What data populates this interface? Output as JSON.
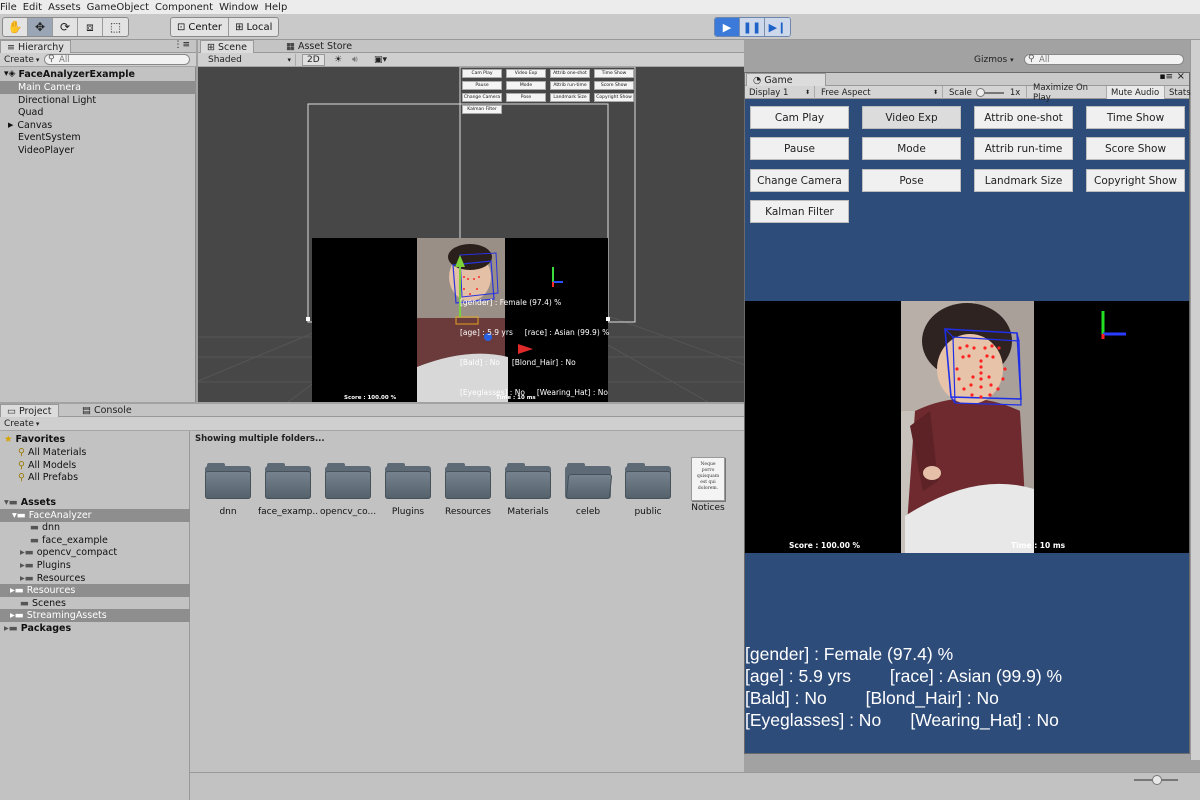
{
  "menu": [
    "File",
    "Edit",
    "Assets",
    "GameObject",
    "Component",
    "Window",
    "Help"
  ],
  "toolbar": {
    "tools": [
      "hand-icon",
      "move-icon",
      "rotate-icon",
      "scale-icon",
      "rect-icon"
    ],
    "pivot": "Center",
    "space": "Local",
    "play_controls": [
      "play-icon",
      "pause-icon",
      "step-icon"
    ]
  },
  "hierarchy": {
    "tab": "Hierarchy",
    "create": "Create",
    "search_placeholder": "All",
    "scene": "FaceAnalyzerExample",
    "items": [
      "Main Camera",
      "Directional Light",
      "Quad",
      "Canvas",
      "EventSystem",
      "VideoPlayer"
    ]
  },
  "scene": {
    "tabs": [
      "Scene",
      "Asset Store"
    ],
    "shading": "Shaded",
    "mode_2d": "2D",
    "gizmos": "Gizmos",
    "search_placeholder": "All",
    "mini_buttons": [
      "Cam Play",
      "Video Exp",
      "Attrib one-shot",
      "Time Show",
      "Pause",
      "Mode",
      "Attrib run-time",
      "Score Show",
      "Change Camera",
      "Pose",
      "Landmark Size",
      "Copyright Show",
      "Kalman Filter"
    ],
    "overlay_lines": [
      "[gender] : Female (97.4) %",
      "[age] : 5.9 yrs     [race] : Asian (99.9) %",
      "[Bald] : No     [Blond_Hair] : No",
      "[Eyeglasses] : No     [Wearing_Hat] : No"
    ],
    "score": "Score : 100.00 %",
    "time": "Time : 10 ms"
  },
  "project": {
    "tabs": [
      "Project",
      "Console"
    ],
    "create": "Create",
    "header": "Showing multiple folders...",
    "favorites_label": "Favorites",
    "favorites": [
      "All Materials",
      "All Models",
      "All Prefabs"
    ],
    "assets_label": "Assets",
    "tree": [
      {
        "label": "FaceAnalyzer",
        "indent": 1,
        "selected": true
      },
      {
        "label": "dnn",
        "indent": 2,
        "selected": false
      },
      {
        "label": "face_example",
        "indent": 2,
        "selected": false
      },
      {
        "label": "opencv_compact",
        "indent": 2,
        "selected": false
      },
      {
        "label": "Plugins",
        "indent": 2,
        "selected": false
      },
      {
        "label": "Resources",
        "indent": 2,
        "selected": false
      },
      {
        "label": "Resources",
        "indent": 1,
        "selected": true
      },
      {
        "label": "Scenes",
        "indent": 1,
        "selected": false
      },
      {
        "label": "StreamingAssets",
        "indent": 1,
        "selected": true
      }
    ],
    "packages_label": "Packages",
    "folders": [
      "dnn",
      "face_examp...",
      "opencv_co...",
      "Plugins",
      "Resources",
      "Materials",
      "celeb",
      "public",
      "Notices"
    ],
    "notices_preview": "Neque porro quisquam est qui dolorem."
  },
  "game": {
    "tab": "Game",
    "display": "Display 1",
    "aspect": "Free Aspect",
    "scale_label": "Scale",
    "scale_value": "1x",
    "maximize": "Maximize On Play",
    "mute": "Mute Audio",
    "stats": "Stats",
    "buttons": [
      "Cam Play",
      "Video Exp",
      "Attrib one-shot",
      "Time Show",
      "Pause",
      "Mode",
      "Attrib run-time",
      "Score Show",
      "Change Camera",
      "Pose",
      "Landmark Size",
      "Copyright Show",
      "Kalman Filter"
    ],
    "score": "Score : 100.00 %",
    "time": "Time : 10 ms",
    "attributes": [
      "[gender] : Female (97.4) %",
      "[age] : 5.9 yrs        [race] : Asian (99.9) %",
      "[Bald] : No        [Blond_Hair] : No",
      "[Eyeglasses] : No      [Wearing_Hat] : No"
    ]
  },
  "colors": {
    "game_bg": "#2e4c7a",
    "selection": "#8e8e8e",
    "play_active": "#3b7ad8"
  }
}
